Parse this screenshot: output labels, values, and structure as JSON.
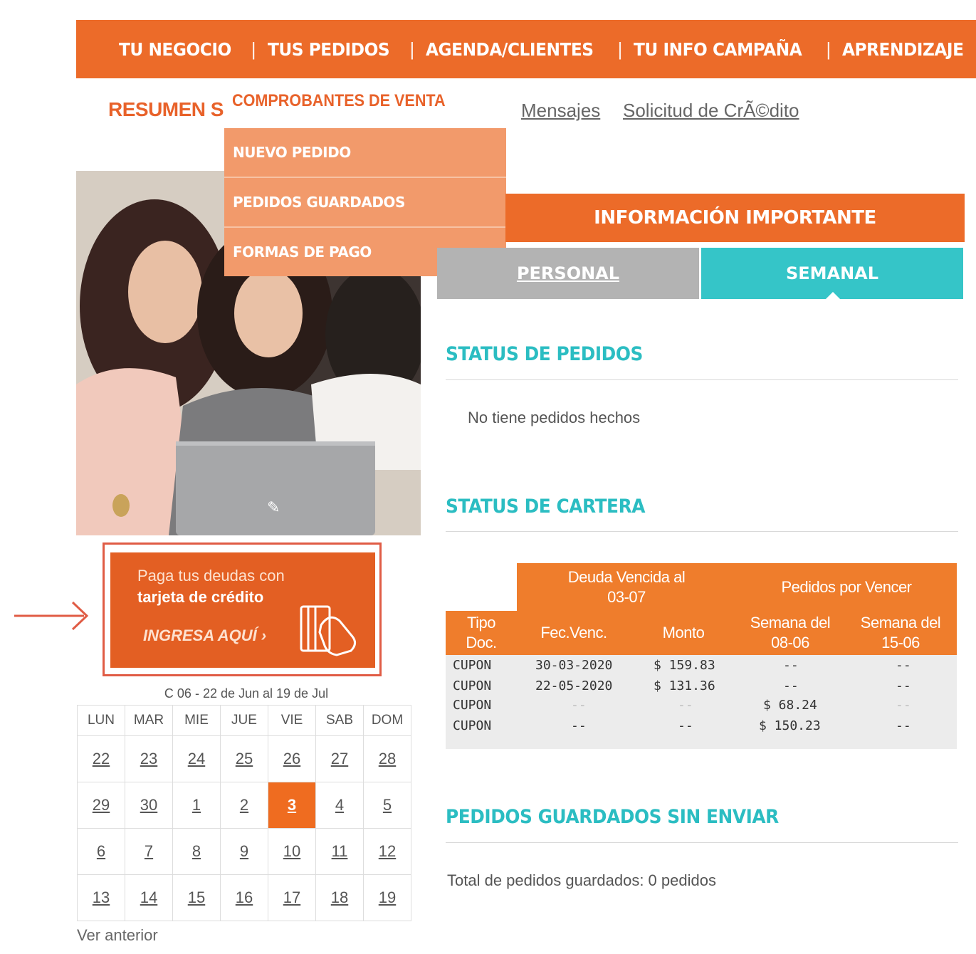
{
  "nav": {
    "items": [
      "TU NEGOCIO",
      "TUS PEDIDOS",
      "AGENDA/CLIENTES",
      "TU INFO CAMPAÑA",
      "APRENDIZAJE"
    ]
  },
  "subnav": {
    "resumen": "RESUMEN S",
    "comprobantes": "COMPROBANTES DE VENTA",
    "mensajes": "Mensajes",
    "solicitud": "Solicitud de CrÃ©dito"
  },
  "dropdown": {
    "items": [
      "NUEVO PEDIDO",
      "PEDIDOS GUARDADOS",
      "FORMAS DE PAGO"
    ]
  },
  "credit_banner": {
    "line1": "Paga tus deudas con",
    "line2": "tarjeta de crédito",
    "cta": "INGRESA AQUÍ ›",
    "outline_color": "#e05c45"
  },
  "calendar": {
    "range": "C 06 - 22 de Jun al 19 de Jul",
    "days": [
      "LUN",
      "MAR",
      "MIE",
      "JUE",
      "VIE",
      "SAB",
      "DOM"
    ],
    "weeks": [
      [
        "22",
        "23",
        "24",
        "25",
        "26",
        "27",
        "28"
      ],
      [
        "29",
        "30",
        "1",
        "2",
        "3",
        "4",
        "5"
      ],
      [
        "6",
        "7",
        "8",
        "9",
        "10",
        "11",
        "12"
      ],
      [
        "13",
        "14",
        "15",
        "16",
        "17",
        "18",
        "19"
      ]
    ],
    "today": "3",
    "ver_anterior": "Ver anterior"
  },
  "info": {
    "header": "INFORMACIÓN IMPORTANTE",
    "tab_personal": "PERSONAL",
    "tab_semanal": "SEMANAL"
  },
  "status_pedidos": {
    "title": "STATUS DE PEDIDOS",
    "text": "No tiene pedidos hechos"
  },
  "status_cartera": {
    "title": "STATUS DE CARTERA",
    "group_vencida": "Deuda Vencida al",
    "group_vencida_date": "03-07",
    "group_vencer": "Pedidos por Vencer",
    "col_tipo_1": "Tipo",
    "col_tipo_2": "Doc.",
    "col_fec": "Fec.Venc.",
    "col_monto": "Monto",
    "col_sem1_1": "Semana del",
    "col_sem1_2": "08-06",
    "col_sem2_1": "Semana del",
    "col_sem2_2": "15-06",
    "rows": [
      [
        "CUPON",
        "30-03-2020",
        "$ 159.83",
        "--",
        "--"
      ],
      [
        "CUPON",
        "22-05-2020",
        "$ 131.36",
        "--",
        "--"
      ],
      [
        "CUPON",
        "--",
        "--",
        "$ 68.24",
        "--"
      ],
      [
        "CUPON",
        "--",
        "--",
        "$ 150.23",
        "--"
      ]
    ]
  },
  "guardados": {
    "title": "PEDIDOS GUARDADOS SIN ENVIAR",
    "text": "Total de pedidos guardados: 0 pedidos"
  },
  "colors": {
    "brand_orange": "#ec6b29",
    "teal": "#35c5c8",
    "dropdown": "#f29a6b"
  }
}
